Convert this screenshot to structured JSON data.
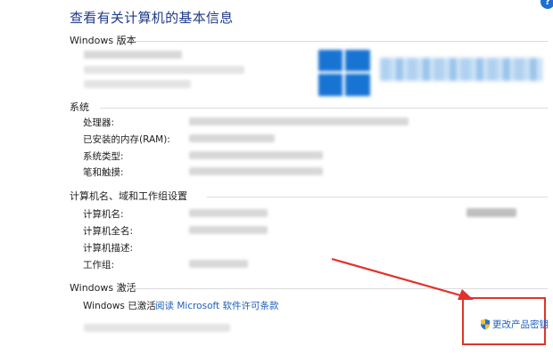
{
  "header": {
    "title": "查看有关计算机的基本信息",
    "help_glyph": "?"
  },
  "edition": {
    "section_label": "Windows 版本"
  },
  "system": {
    "section_label": "系统",
    "processor_label": "处理器:",
    "ram_label": "已安装的内存(RAM):",
    "type_label": "系统类型:",
    "pen_label": "笔和触摸:"
  },
  "computer": {
    "section_label": "计算机名、域和工作组设置",
    "name_label": "计算机名:",
    "fullname_label": "计算机全名:",
    "desc_label": "计算机描述:",
    "workgroup_label": "工作组:"
  },
  "activation": {
    "section_label": "Windows 激活",
    "status_text": "Windows 已激活",
    "license_link": "阅读 Microsoft 软件许可条款",
    "change_key_link": "更改产品密钥"
  },
  "colors": {
    "title": "#1e3a8a",
    "link": "#1d5fbf",
    "annotation": "#e0332b",
    "windows_blue": "#1874d2"
  },
  "icons": {
    "help": "help-icon",
    "shield": "uac-shield-icon"
  }
}
